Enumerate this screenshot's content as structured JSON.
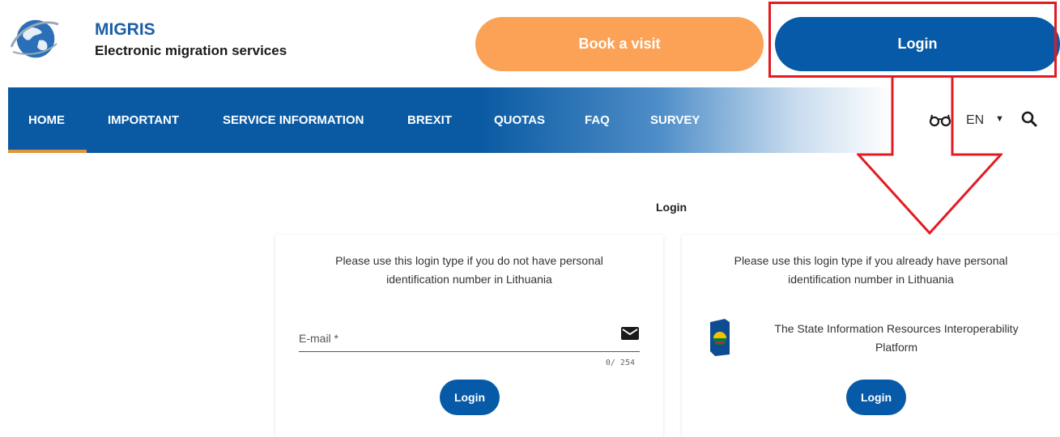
{
  "header": {
    "brand_name": "MIGRIS",
    "brand_subtitle": "Electronic migration services",
    "book_visit_label": "Book a visit",
    "login_label": "Login"
  },
  "nav": {
    "items": [
      {
        "label": "HOME",
        "active": true
      },
      {
        "label": "IMPORTANT"
      },
      {
        "label": "SERVICE INFORMATION"
      },
      {
        "label": "BREXIT"
      },
      {
        "label": "QUOTAS"
      },
      {
        "label": "FAQ"
      },
      {
        "label": "SURVEY"
      }
    ],
    "accessibility_glyph": "🕶",
    "language": "EN",
    "language_caret": "▼"
  },
  "main": {
    "page_title": "Login",
    "left_card": {
      "description": "Please use this login type if you do not have personal\nidentification number in Lithuania",
      "email_label": "E-mail *",
      "email_value": "",
      "email_counter": "0/ 254",
      "login_label": "Login"
    },
    "right_card": {
      "description": "Please use this login type if you already have personal\nidentification number in Lithuania",
      "platform_name": "The State Information Resources Interoperability\nPlatform",
      "login_label": "Login"
    }
  },
  "colors": {
    "brand_blue": "#075aa7",
    "book_orange": "#fba257",
    "annotation_red": "#e21b22",
    "nav_active_underline": "#e0953f"
  },
  "icons": [
    "globe-logo-icon",
    "glasses-icon",
    "search-icon",
    "envelope-icon",
    "platform-logo-icon",
    "annotation-arrow"
  ]
}
